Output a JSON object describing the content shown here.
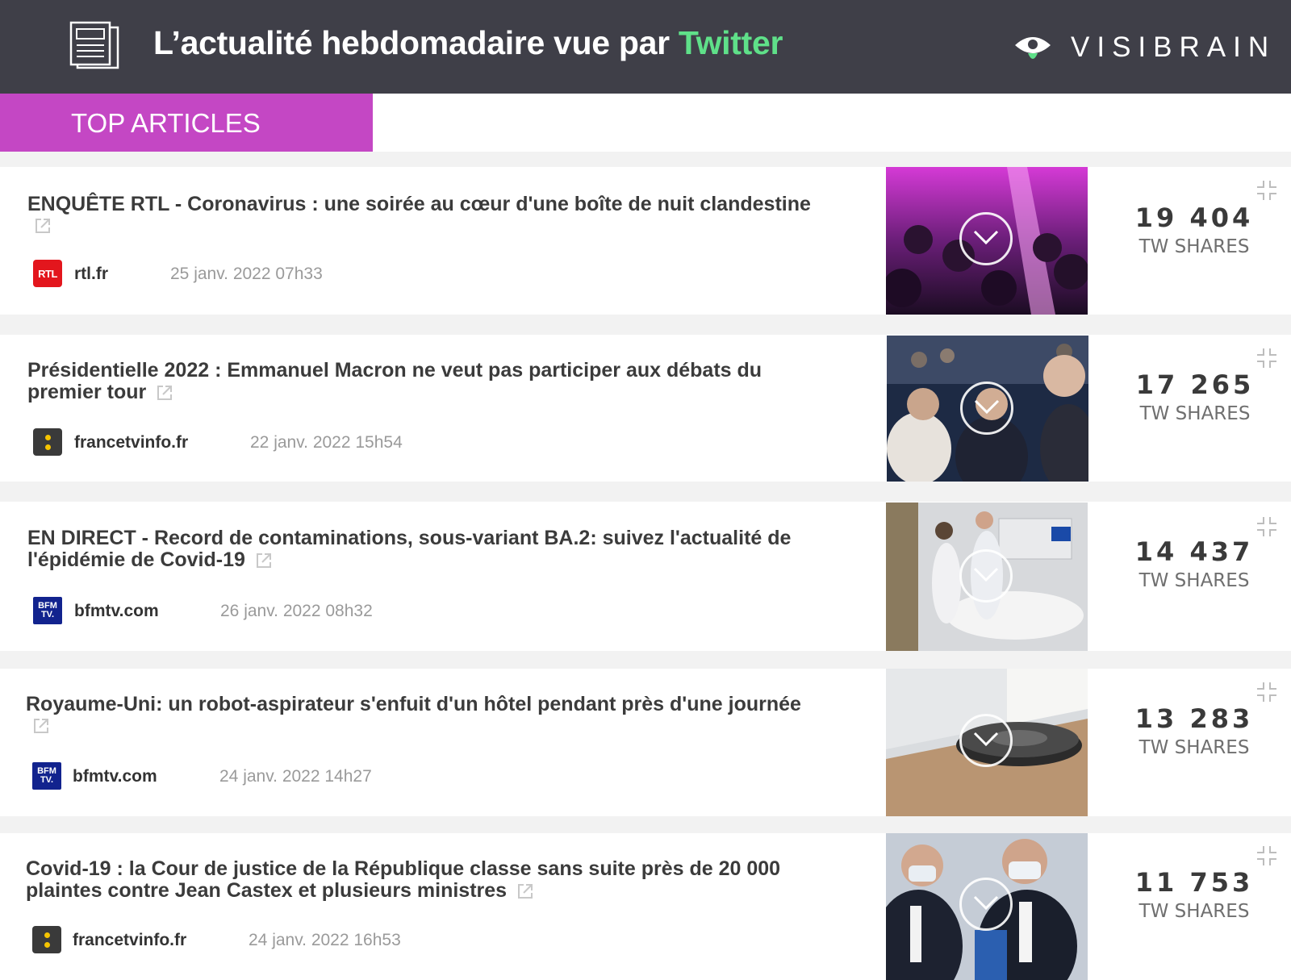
{
  "header": {
    "title_prefix": "L’actualité hebdomadaire vue par ",
    "title_accent": "Twitter",
    "brand": "VISIBRAIN",
    "accent_color": "#5fe089",
    "background_color": "#3f3f48"
  },
  "section": {
    "label": "TOP ARTICLES",
    "color": "#c447c4"
  },
  "articles": [
    {
      "title": "ENQUÊTE RTL - Coronavirus : une soirée au cœur d'une boîte de nuit clandestine",
      "source": "rtl.fr",
      "source_logo": "rtl-logo",
      "date": "25 janv. 2022 07h33",
      "shares": "19 404",
      "shares_label": "TW SHARES",
      "thumbnail": "nightclub-crowd-image"
    },
    {
      "title": "Présidentielle 2022 : Emmanuel Macron ne veut pas participer aux débats du premier tour",
      "source": "francetvinfo.fr",
      "source_logo": "francetvinfo-logo",
      "date": "22 janv. 2022 15h54",
      "shares": "17 265",
      "shares_label": "TW SHARES",
      "thumbnail": "debate-image"
    },
    {
      "title": "EN DIRECT - Record de contaminations, sous-variant BA.2: suivez l'actualité de l'épidémie de Covid-19",
      "source": "bfmtv.com",
      "source_logo": "bfmtv-logo",
      "date": "26 janv. 2022 08h32",
      "shares": "14 437",
      "shares_label": "TW SHARES",
      "thumbnail": "hospital-image"
    },
    {
      "title": "Royaume-Uni: un robot-aspirateur s'enfuit d'un hôtel pendant près d'une journée",
      "source": "bfmtv.com",
      "source_logo": "bfmtv-logo",
      "date": "24 janv. 2022 14h27",
      "shares": "13 283",
      "shares_label": "TW SHARES",
      "thumbnail": "robot-vacuum-image"
    },
    {
      "title": "Covid-19 : la Cour de justice de la République classe sans suite près de 20 000 plaintes contre Jean Castex et plusieurs ministres",
      "source": "francetvinfo.fr",
      "source_logo": "francetvinfo-logo",
      "date": "24 janv. 2022 16h53",
      "shares": "11 753",
      "shares_label": "TW SHARES",
      "thumbnail": "ministers-image"
    }
  ]
}
